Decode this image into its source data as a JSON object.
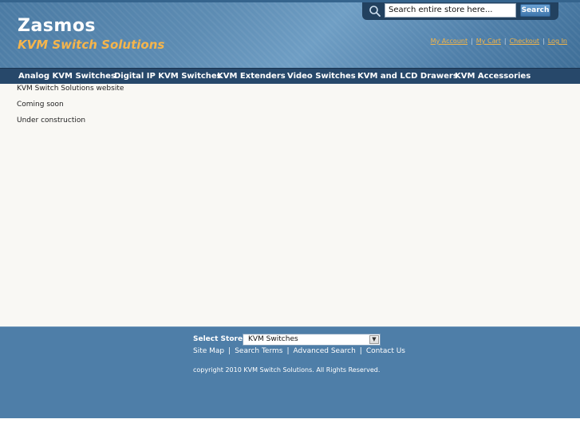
{
  "header": {
    "logo_name": "Zasmos",
    "logo_tagline": "KVM Switch Solutions",
    "search_placeholder": "Search entire store here...",
    "search_button": "Search",
    "account_links": [
      "My Account",
      "My Cart",
      "Checkout",
      "Log In"
    ]
  },
  "nav": {
    "items": [
      "Analog KVM Switches",
      "Digital IP KVM Switches",
      "KVM Extenders",
      "Video Switches",
      "KVM and LCD Drawers",
      "KVM Accessories"
    ]
  },
  "content": {
    "lines": [
      "KVM Switch Solutions website",
      "Coming soon",
      "Under construction"
    ]
  },
  "footer": {
    "store_label": "Select Store:",
    "store_selected": "KVM Switches",
    "links": [
      "Site Map",
      "Search Terms",
      "Advanced Search",
      "Contact Us"
    ],
    "copyright": "copyright 2010 KVM Switch Solutions. All Rights Reserved."
  },
  "colors": {
    "header_bg": "#5d8cb3",
    "nav_bg": "#27486a",
    "accent_orange": "#f6b54b",
    "content_bg": "#f9f8f4",
    "footer_bg": "#4e7ea8"
  }
}
